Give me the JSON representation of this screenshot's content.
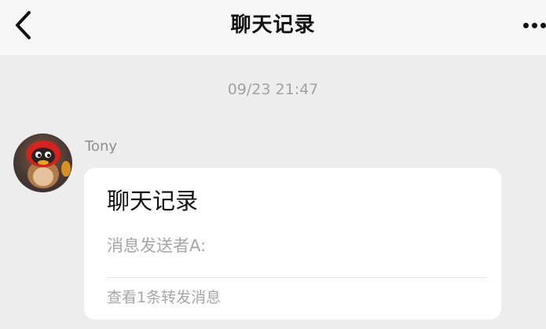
{
  "header": {
    "title": "聊天记录",
    "back_icon": "chevron-left-icon",
    "more_icon": "more-dots-icon"
  },
  "chat": {
    "timestamp": "09/23 21:47",
    "message": {
      "sender": "Tony",
      "avatar_icon": "penguin-avatar",
      "card": {
        "title": "聊天记录",
        "preview": "消息发送者A:",
        "footer": "查看1条转发消息"
      }
    }
  },
  "colors": {
    "background": "#ededed",
    "nav_bar": "#f7f7f7",
    "card": "#ffffff",
    "primary_text": "#111111",
    "secondary_text": "#a6a6a6"
  }
}
